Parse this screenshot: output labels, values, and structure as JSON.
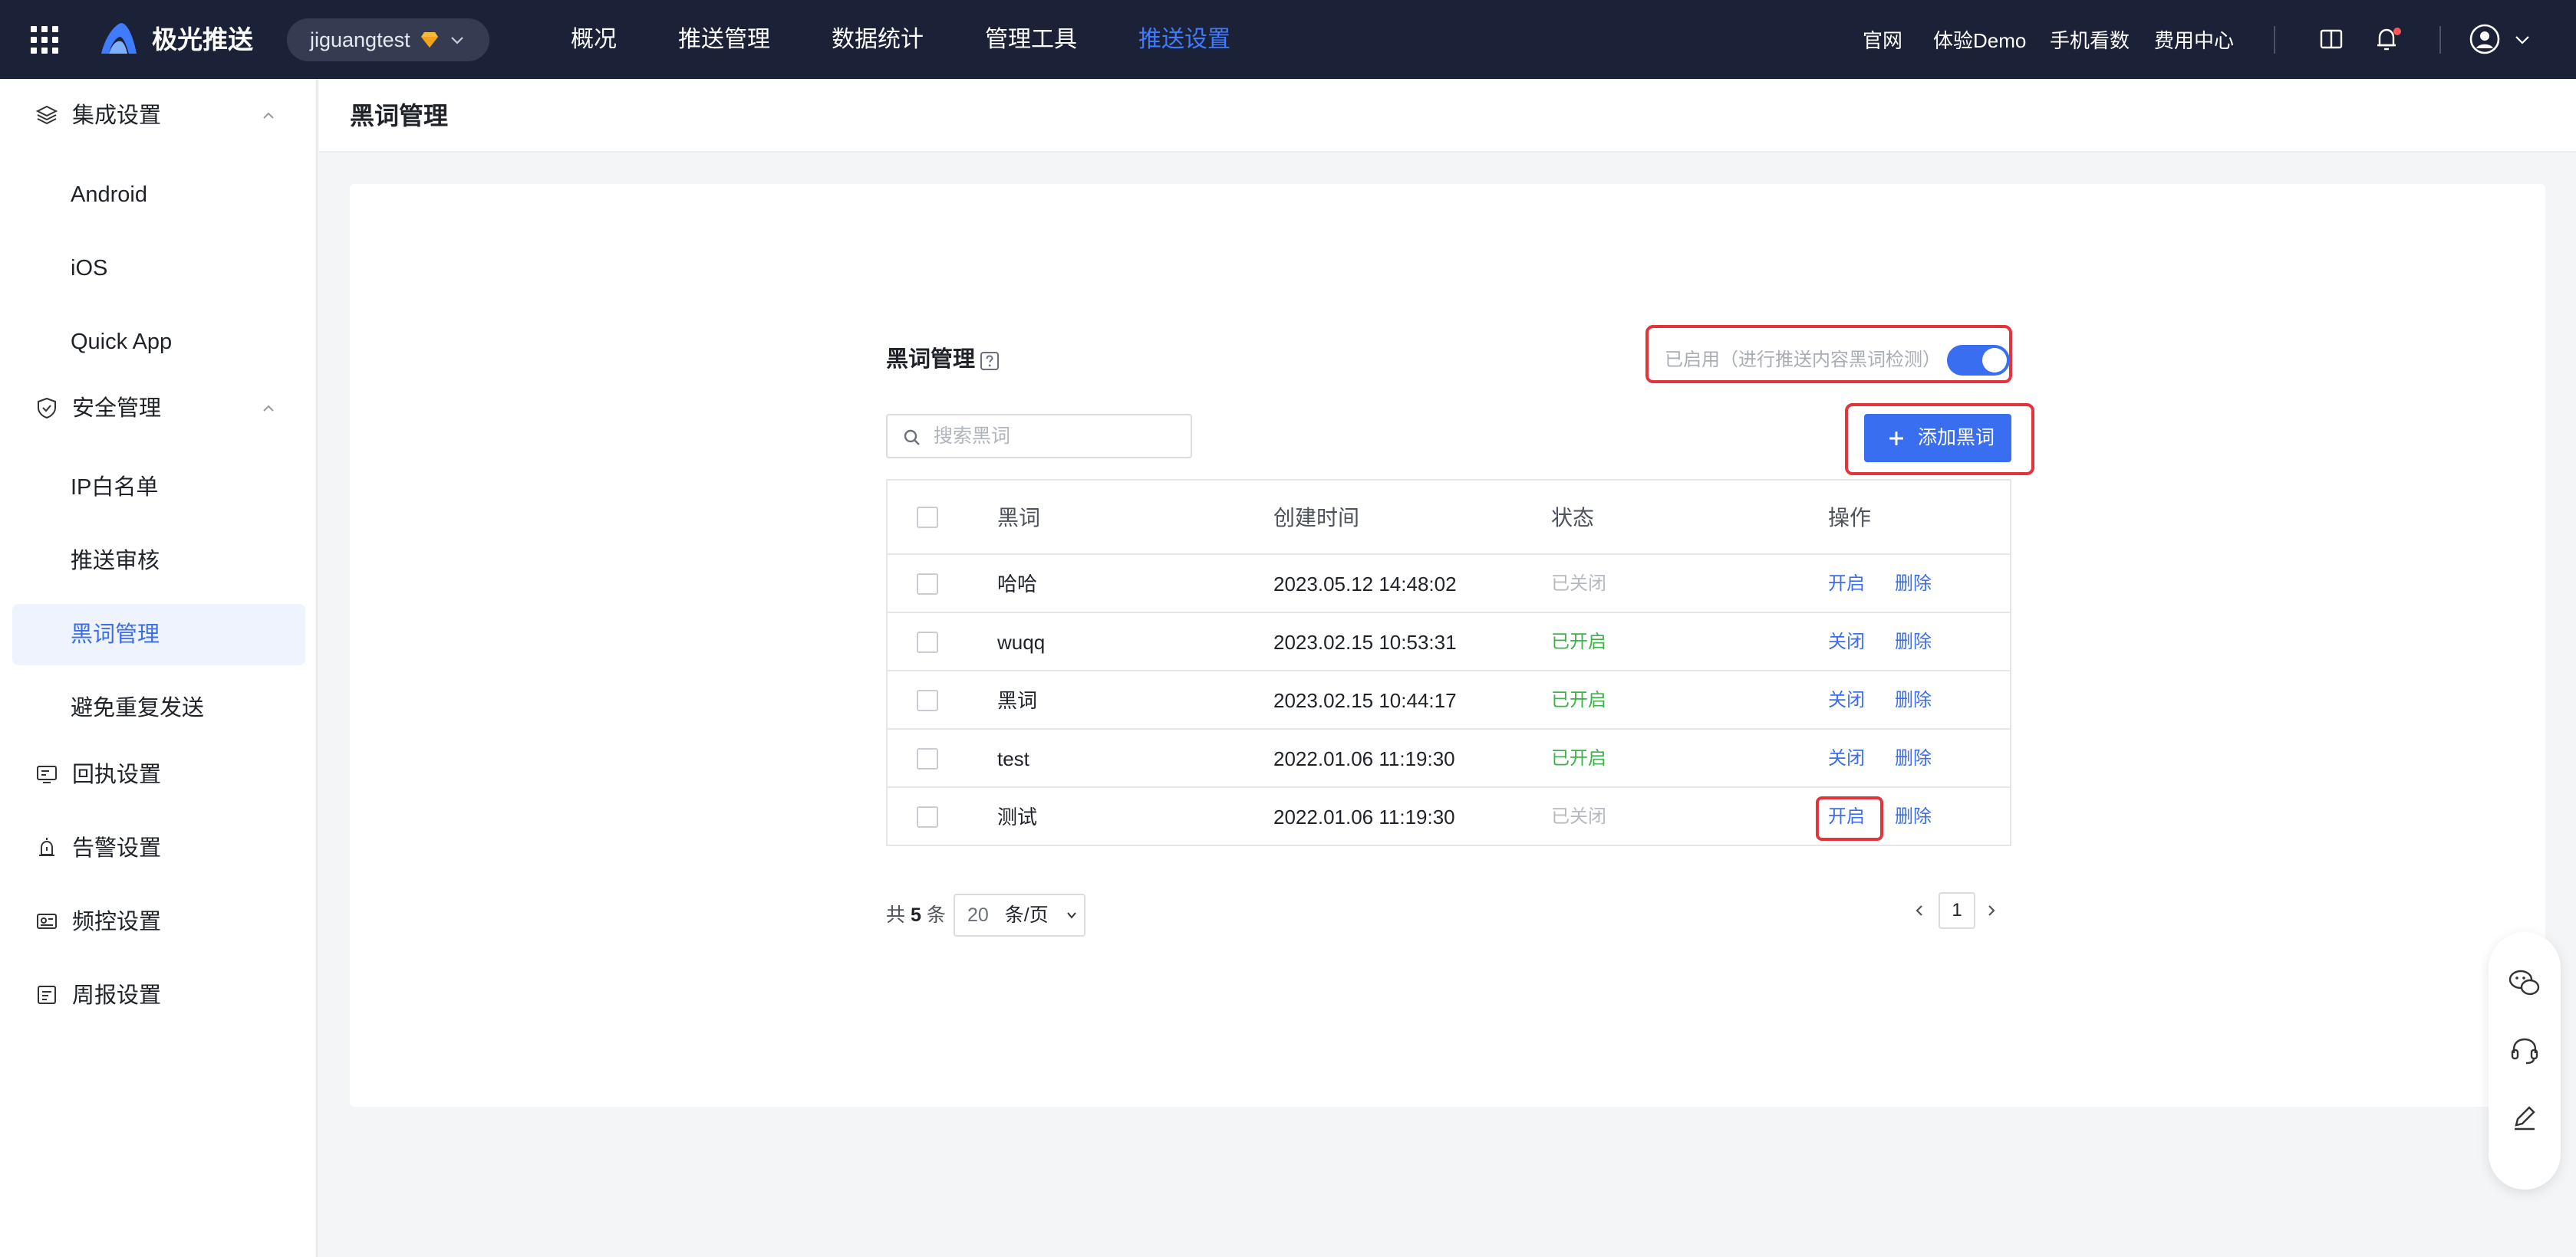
{
  "topbar": {
    "brand": "极光推送",
    "app_name": "jiguangtest",
    "nav": [
      "概况",
      "推送管理",
      "数据统计",
      "管理工具",
      "推送设置"
    ],
    "nav_active_index": 4,
    "links": [
      "官网",
      "体验Demo",
      "手机看数",
      "费用中心"
    ],
    "icons": [
      "apps-grid-icon",
      "aurora-logo-icon",
      "vip-gem-icon",
      "docs-book-icon",
      "bell-icon",
      "user-avatar-icon"
    ]
  },
  "sidebar": {
    "groups": [
      {
        "label": "集成设置",
        "icon": "layers-icon",
        "expanded": true,
        "items": [
          "Android",
          "iOS",
          "Quick App"
        ]
      },
      {
        "label": "安全管理",
        "icon": "shield-icon",
        "expanded": true,
        "items": [
          "IP白名单",
          "推送审核",
          "黑词管理",
          "避免重复发送"
        ]
      },
      {
        "label": "回执设置",
        "icon": "receipt-monitor-icon"
      },
      {
        "label": "告警设置",
        "icon": "alarm-icon"
      },
      {
        "label": "频控设置",
        "icon": "rate-control-icon"
      },
      {
        "label": "周报设置",
        "icon": "report-icon"
      }
    ],
    "active_item": "黑词管理"
  },
  "page": {
    "title": "黑词管理",
    "section_title": "黑词管理",
    "toggle_label": "已启用（进行推送内容黑词检测）",
    "toggle_on": true,
    "search_placeholder": "搜索黑词",
    "add_button": "添加黑词"
  },
  "table": {
    "headers": [
      "黑词",
      "创建时间",
      "状态",
      "操作"
    ],
    "rows": [
      {
        "word": "哈哈",
        "created": "2023.05.12 14:48:02",
        "status": "已关闭",
        "status_on": false,
        "toggle_action": "开启",
        "delete_action": "删除"
      },
      {
        "word": "wuqq",
        "created": "2023.02.15 10:53:31",
        "status": "已开启",
        "status_on": true,
        "toggle_action": "关闭",
        "delete_action": "删除"
      },
      {
        "word": "黑词",
        "created": "2023.02.15 10:44:17",
        "status": "已开启",
        "status_on": true,
        "toggle_action": "关闭",
        "delete_action": "删除"
      },
      {
        "word": "test",
        "created": "2022.01.06 11:19:30",
        "status": "已开启",
        "status_on": true,
        "toggle_action": "关闭",
        "delete_action": "删除"
      },
      {
        "word": "测试",
        "created": "2022.01.06 11:19:30",
        "status": "已关闭",
        "status_on": false,
        "toggle_action": "开启",
        "delete_action": "删除"
      }
    ]
  },
  "pagination": {
    "prefix": "共",
    "total": "5",
    "suffix": "条",
    "page_size": "20",
    "page_size_unit": "条/页",
    "current_page": "1"
  },
  "float_tools": [
    "wechat-chat-icon",
    "customer-service-headset-icon",
    "edit-feedback-icon"
  ],
  "colors": {
    "topbar_bg": "#1b2238",
    "accent": "#3a6ef0",
    "status_on": "#3bb346",
    "status_off": "#b5b9c1",
    "highlight_box": "#e2343a"
  }
}
